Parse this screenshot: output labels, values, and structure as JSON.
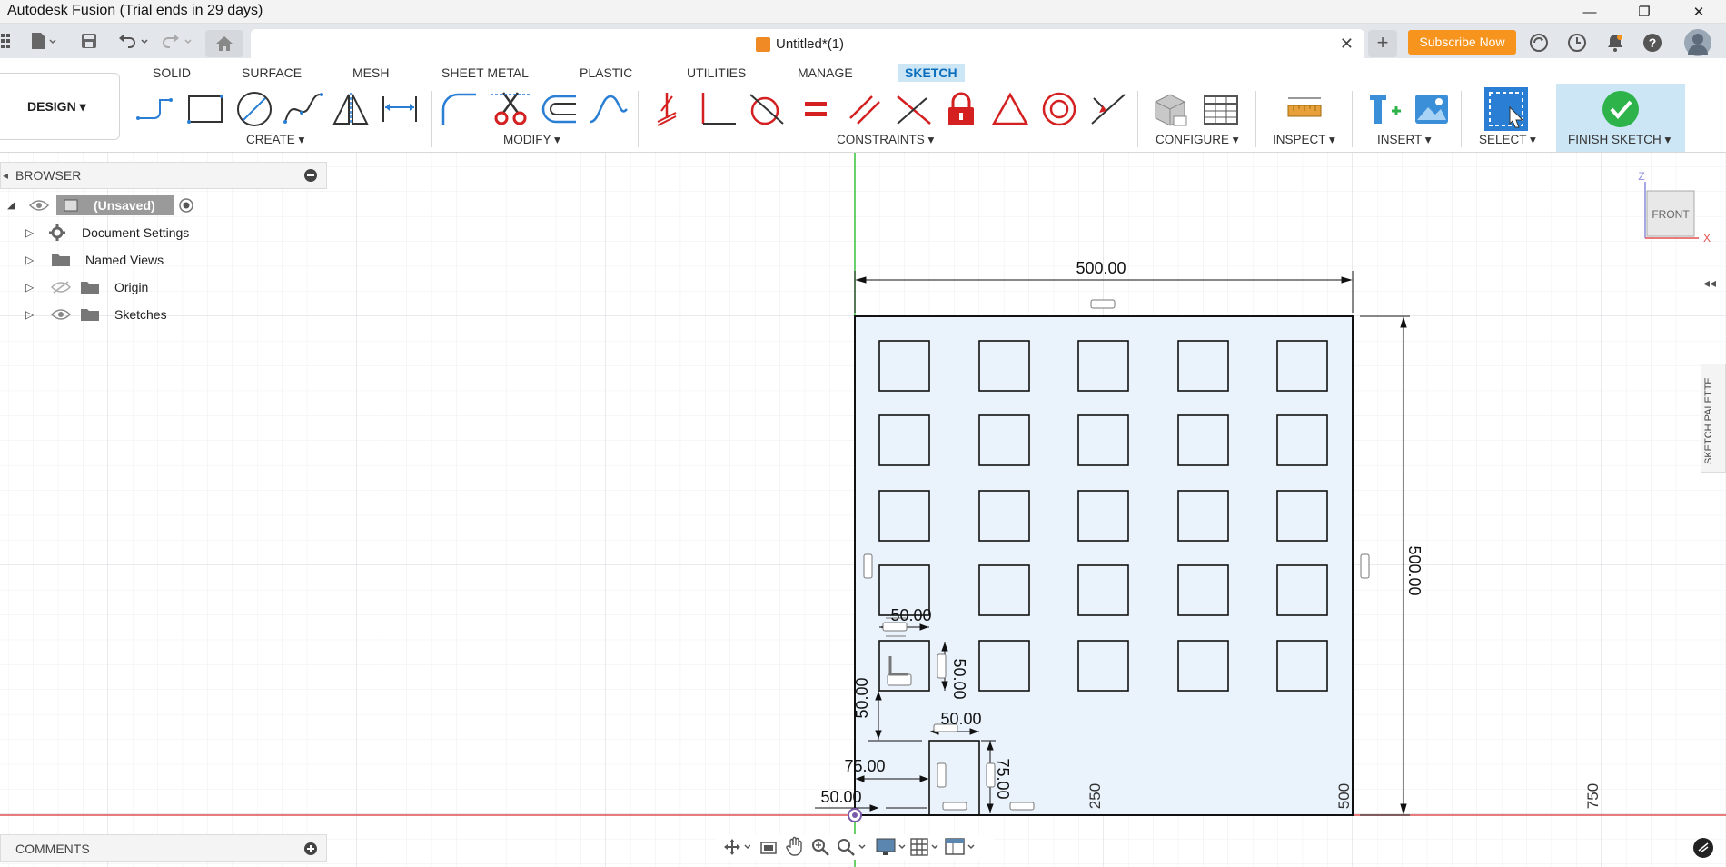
{
  "window": {
    "title": "Autodesk Fusion (Trial ends in 29 days)",
    "minimize": "—",
    "restore": "❐",
    "close": "✕"
  },
  "doc_tab": {
    "label": "Untitled*(1)",
    "close": "✕"
  },
  "header": {
    "new_tab": "+",
    "subscribe": "Subscribe Now"
  },
  "workspace": {
    "design_label": "DESIGN ▾",
    "tabs": [
      "SOLID",
      "SURFACE",
      "MESH",
      "SHEET METAL",
      "PLASTIC",
      "UTILITIES",
      "MANAGE",
      "SKETCH"
    ],
    "active_tab": "SKETCH"
  },
  "tool_groups": {
    "create": "CREATE ▾",
    "modify": "MODIFY ▾",
    "constraints": "CONSTRAINTS ▾",
    "configure": "CONFIGURE ▾",
    "inspect": "INSPECT ▾",
    "insert": "INSERT ▾",
    "select": "SELECT ▾",
    "finish": "FINISH SKETCH ▾"
  },
  "browser": {
    "header": "BROWSER",
    "root": "(Unsaved)",
    "items": [
      "Document Settings",
      "Named Views",
      "Origin",
      "Sketches"
    ]
  },
  "comments": {
    "header": "COMMENTS"
  },
  "sketch_palette": {
    "label": "SKETCH PALETTE"
  },
  "viewcube": {
    "face": "FRONT",
    "z_axis": "Z",
    "x_axis": "X"
  },
  "sketch": {
    "dimensions": {
      "width": "500.00",
      "height": "500.00",
      "square_width": "50.00",
      "square_height": "50.00",
      "square_offset_y": "50.00",
      "slot_width": "50.00",
      "slot_height": "75.00",
      "slot_offset_x": "75.00",
      "square_offset_x": "50.00"
    },
    "axis_ticks": [
      "250",
      "500",
      "750"
    ]
  },
  "colors": {
    "accent": "#0a6ebd",
    "subscribe": "#f7941d",
    "sketch_fill": "#eaf3fb",
    "x_axis": "#e05050",
    "y_axis": "#38c038",
    "finish_check": "#2db34a"
  }
}
